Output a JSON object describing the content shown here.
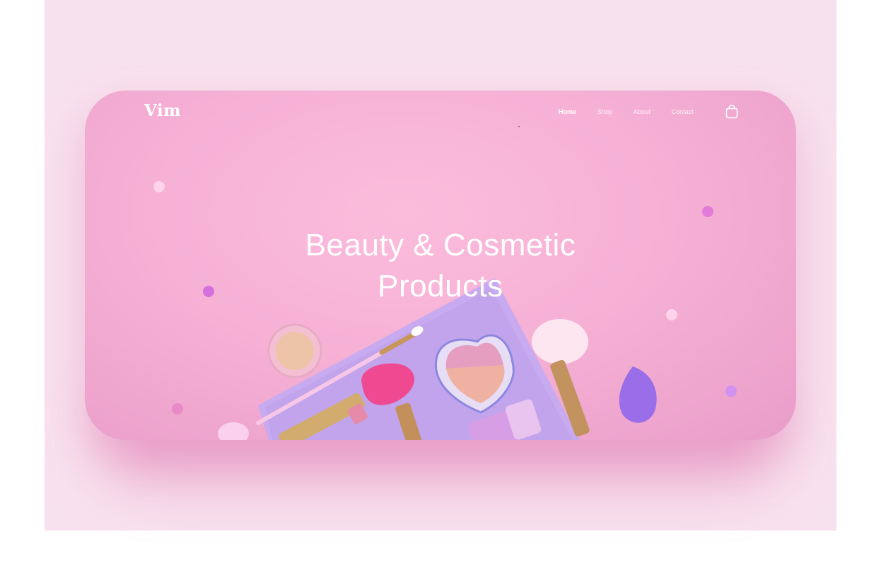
{
  "brand": {
    "logo": "Vim"
  },
  "nav": {
    "items": [
      {
        "label": "Home",
        "active": true
      },
      {
        "label": "Shop",
        "active": false
      },
      {
        "label": "About",
        "active": false
      },
      {
        "label": "Contact",
        "active": false
      }
    ],
    "cart_icon": "shopping-bag-icon"
  },
  "hero": {
    "title_line1": "Beauty & Cosmetic",
    "title_line2": "Products"
  },
  "colors": {
    "page_background": "#f8e1ee",
    "hero_pink": "#f6b1d5",
    "accent_purple": "#c98ce6",
    "text": "#ffffff"
  }
}
